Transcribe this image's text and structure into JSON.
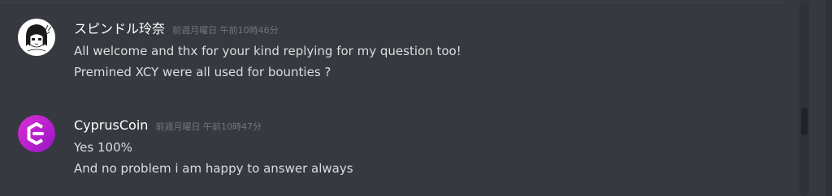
{
  "messages": [
    {
      "author": "スピンドル玲奈",
      "timestamp": "前週月曜日 午前10時46分",
      "lines": [
        "All welcome and thx for your kind replying for my question too!",
        "Premined XCY were all used for bounties ?"
      ],
      "avatar_icon": "anime-girl-sketch-avatar"
    },
    {
      "author": "CyprusCoin",
      "timestamp": "前週月曜日 午前10時47分",
      "lines": [
        "Yes 100%",
        "And no problem i am happy to answer always"
      ],
      "avatar_icon": "cypruscoin-logo-avatar"
    }
  ],
  "colors": {
    "background": "#36393f",
    "username": "#ffffff",
    "timestamp": "#72767d",
    "message_text": "#dcddde",
    "cypruscoin_brand": "#c31fd0"
  }
}
